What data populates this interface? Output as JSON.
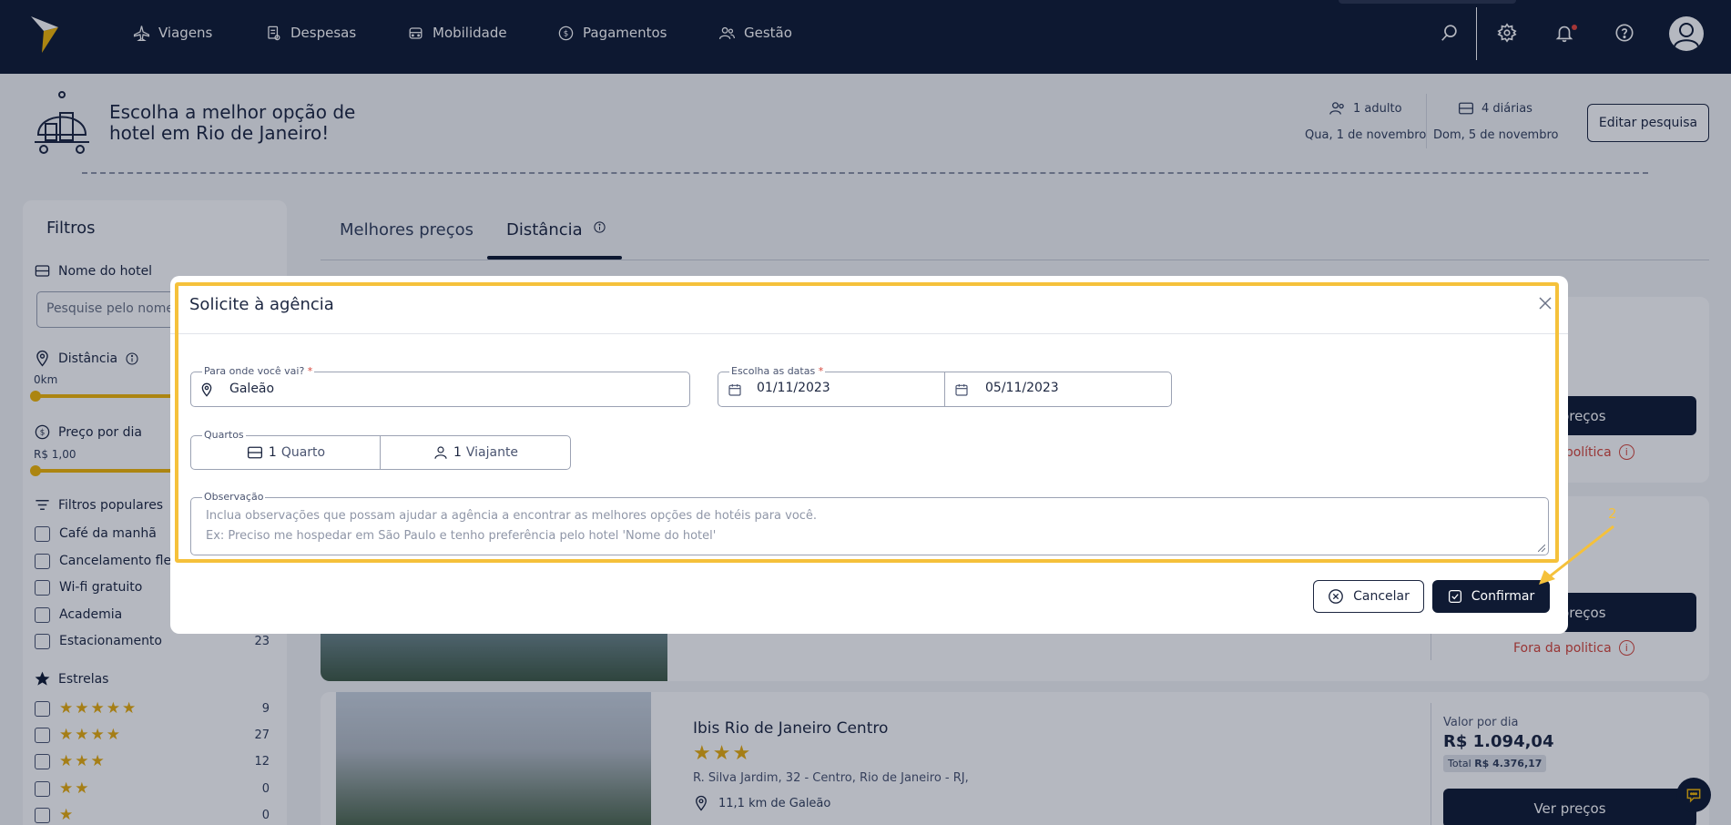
{
  "nav": {
    "items": [
      {
        "label": "Viagens",
        "icon": "plane-icon"
      },
      {
        "label": "Despesas",
        "icon": "receipt-icon"
      },
      {
        "label": "Mobilidade",
        "icon": "car-icon"
      },
      {
        "label": "Pagamentos",
        "icon": "dollar-circle-icon"
      },
      {
        "label": "Gestão",
        "icon": "users-icon"
      }
    ],
    "right_icons": [
      "search-icon",
      "gear-icon",
      "bell-icon",
      "help-icon",
      "avatar-icon"
    ]
  },
  "header": {
    "title": "Escolha a melhor opção de hotel em Rio de Janeiro!",
    "guests": "1 adulto",
    "nights": "4 diárias",
    "checkin": "Qua, 1 de novembro",
    "checkout": "Dom, 5 de novembro",
    "edit_label": "Editar pesquisa"
  },
  "sidebar": {
    "title": "Filtros",
    "hotel_name_label": "Nome do hotel",
    "hotel_name_placeholder": "Pesquise pelo nome",
    "distance_label": "Distância",
    "distance_min": "0km",
    "price_label": "Preço por dia",
    "price_min": "R$ 1,00",
    "popular_label": "Filtros populares",
    "popular": [
      {
        "label": "Café da manhã",
        "count": ""
      },
      {
        "label": "Cancelamento flexí",
        "count": ""
      },
      {
        "label": "Wi-fi gratuito",
        "count": ""
      },
      {
        "label": "Academia",
        "count": ""
      },
      {
        "label": "Estacionamento",
        "count": "23"
      }
    ],
    "stars_label": "Estrelas",
    "stars": [
      {
        "stars": "★★★★★",
        "count": "9"
      },
      {
        "stars": "★★★★",
        "count": "27"
      },
      {
        "stars": "★★★",
        "count": "12"
      },
      {
        "stars": "★★",
        "count": "0"
      },
      {
        "stars": "★",
        "count": "0"
      }
    ]
  },
  "tabs": [
    {
      "label": "Melhores preços",
      "active": false
    },
    {
      "label": "Distância",
      "active": true
    }
  ],
  "results": {
    "card1": {
      "button": "Ver preços",
      "policy": "Fora da política"
    },
    "card2": {
      "button": "Ver preços",
      "policy": "Fora da politica"
    },
    "card3": {
      "name": "Ibis Rio de Janeiro Centro",
      "stars": "★★★",
      "address": "R. Silva Jardim, 32 - Centro, Rio de Janeiro - RJ,",
      "distance": "11,1 km de Galeão",
      "price_label": "Valor por dia",
      "price": "R$ 1.094,04",
      "total_label": "Total",
      "total": "R$ 4.376,17",
      "button": "Ver preços"
    }
  },
  "modal": {
    "title": "Solicite à agência",
    "destination_label": "Para onde você vai?",
    "destination_value": "Galeão",
    "dates_label": "Escolha as datas",
    "date_from": "01/11/2023",
    "date_to": "05/11/2023",
    "rooms_label": "Quartos",
    "rooms_count": "1",
    "rooms_unit": "Quarto",
    "travelers_count": "1",
    "travelers_unit": "Viajante",
    "obs_label": "Observação",
    "obs_placeholder_1": "Inclua observações que possam ajudar a agência a encontrar as melhores opções de hotéis para você.",
    "obs_placeholder_2": "Ex: Preciso me hospedar em São Paulo e tenho preferência pelo hotel 'Nome do hotel'",
    "cancel_label": "Cancelar",
    "confirm_label": "Confirmar",
    "required_mark": "*"
  },
  "annotation": {
    "step": "2",
    "color": "#f5c13b"
  },
  "colors": {
    "nav_bg": "#0f1a33",
    "accent": "#f2b705",
    "danger": "#d6453a"
  }
}
